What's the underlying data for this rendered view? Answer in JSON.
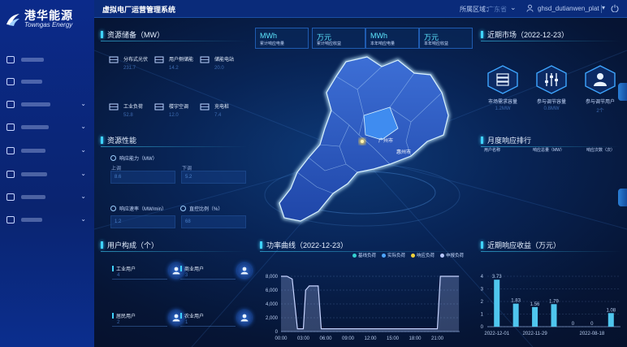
{
  "app": {
    "brand_cn": "港华能源",
    "brand_en": "Towngas Energy",
    "system_title": "虚拟电厂运营管理系统",
    "region_label": "所属区域：",
    "region_value": "广东省",
    "username": "ghsd_dutianwen_plat"
  },
  "sidebar": {
    "items": [
      {
        "icon": "monitor-icon",
        "has_chevron": false
      },
      {
        "icon": "document-icon",
        "has_chevron": false
      },
      {
        "icon": "chat-icon",
        "has_chevron": true
      },
      {
        "icon": "image-icon",
        "has_chevron": true
      },
      {
        "icon": "chart-icon",
        "has_chevron": true
      },
      {
        "icon": "scan-icon",
        "has_chevron": true
      },
      {
        "icon": "database-icon",
        "has_chevron": true
      },
      {
        "icon": "settings-icon",
        "has_chevron": true
      }
    ]
  },
  "storage": {
    "title": "资源储备（MW）",
    "items": [
      {
        "label": "分布式光伏",
        "value": "231.7",
        "icon": "solar-panel-icon"
      },
      {
        "label": "用户侧储能",
        "value": "14.2",
        "icon": "battery-icon"
      },
      {
        "label": "储能电站",
        "value": "20.0",
        "icon": "storage-station-icon"
      },
      {
        "label": "工业负荷",
        "value": "52.8",
        "icon": "factory-icon"
      },
      {
        "label": "楼宇空调",
        "value": "12.0",
        "icon": "building-icon"
      },
      {
        "label": "充电桩",
        "value": "7.4",
        "icon": "charger-icon"
      }
    ]
  },
  "kpis": [
    {
      "value": "MWh",
      "label": "累计响应电量"
    },
    {
      "value": "万元",
      "label": "累计响应收益"
    },
    {
      "value": "MWh",
      "label": "本年响应电量"
    },
    {
      "value": "万元",
      "label": "本年响应收益"
    }
  ],
  "market": {
    "title": "近期市场（2022-12-23）",
    "items": [
      {
        "label": "市场需求容量",
        "value": "1.2MW",
        "icon": "server-icon"
      },
      {
        "label": "参与调节容量",
        "value": "0.8MW",
        "icon": "sliders-icon"
      },
      {
        "label": "参与调节用户",
        "value": "2个",
        "icon": "person-icon"
      }
    ]
  },
  "performance": {
    "title": "资源性能",
    "up_label": "响应能力（MW）",
    "up_sub_left": "上调",
    "up_sub_right": "下调",
    "up_left_value": "8.6",
    "up_right_value": "5.2",
    "rate_label": "响应速率（MW/min）",
    "ratio_label": "直控比例（%）",
    "rate_value": "1.2",
    "ratio_value": "68"
  },
  "map": {
    "city_label": "广州市",
    "city_label2": "惠州市"
  },
  "ranking": {
    "title": "月度响应排行",
    "columns": [
      "用户名称",
      "响应总量（MW）",
      "响应次数（次）"
    ]
  },
  "user_composition": {
    "title": "用户构成（个）",
    "items": [
      {
        "label": "工业用户",
        "value": "4",
        "icon": "factory-user-icon"
      },
      {
        "label": "商业用户",
        "value": "3",
        "icon": "business-user-icon"
      },
      {
        "label": "居民用户",
        "value": "2",
        "icon": "resident-user-icon"
      },
      {
        "label": "农业用户",
        "value": "1",
        "icon": "agri-user-icon"
      }
    ]
  },
  "power_curve": {
    "title": "功率曲线（2022-12-23）",
    "legend": [
      {
        "name": "基线负荷",
        "color": "#33d0d0"
      },
      {
        "name": "实际负荷",
        "color": "#4ea6ff"
      },
      {
        "name": "响应负荷",
        "color": "#f2d23a"
      },
      {
        "name": "申报负荷",
        "color": "#b9c7ff"
      }
    ]
  },
  "revenue": {
    "title": "近期响应收益（万元）"
  },
  "chart_data": [
    {
      "type": "area",
      "title": "功率曲线（2022-12-23）",
      "x": [
        "00:00",
        "03:00",
        "06:00",
        "09:00",
        "12:00",
        "15:00",
        "18:00",
        "21:00"
      ],
      "ylim": [
        0,
        8000
      ],
      "yticks": [
        0,
        2000,
        4000,
        6000,
        8000
      ],
      "series": [
        {
          "name": "基线负荷",
          "points": [
            [
              0.0,
              8000
            ],
            [
              0.8,
              8000
            ],
            [
              1.5,
              7600
            ],
            [
              2.2,
              400
            ],
            [
              3.0,
              400
            ],
            [
              3.3,
              6000
            ],
            [
              3.8,
              6600
            ],
            [
              5.0,
              6600
            ],
            [
              5.4,
              400
            ],
            [
              21.0,
              400
            ],
            [
              21.4,
              8000
            ],
            [
              23.9,
              8000
            ]
          ]
        }
      ]
    },
    {
      "type": "bar",
      "title": "近期响应收益（万元）",
      "categories": [
        "2022-12-01",
        "",
        "2022-11-29",
        "",
        "",
        "2022-08-18",
        ""
      ],
      "values": [
        3.73,
        1.83,
        1.56,
        1.79,
        0.0,
        0.0,
        1.08
      ],
      "ylim": [
        0,
        4
      ],
      "yticks": [
        0,
        1,
        2,
        3,
        4
      ]
    }
  ]
}
